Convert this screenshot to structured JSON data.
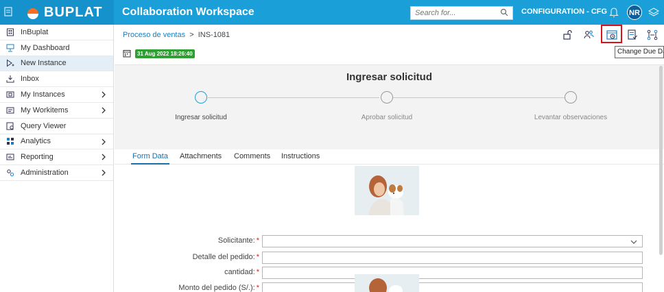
{
  "topbar": {
    "logo_text": "BUPLAT",
    "app_title": "Collaboration Workspace",
    "search_placeholder": "Search for...",
    "config_label": "CONFIGURATION - CFG",
    "avatar_initials": "NR",
    "colors": {
      "bar": "#1a9fd9",
      "brand_dot_a": "#f36f21",
      "brand_dot_b": "#ffffff"
    }
  },
  "sidebar": {
    "items": [
      {
        "label": "InBuplat",
        "icon": "building-icon",
        "has_submenu": false
      },
      {
        "label": "My Dashboard",
        "icon": "dashboard-icon",
        "has_submenu": false
      },
      {
        "label": "New Instance",
        "icon": "new-instance-icon",
        "has_submenu": false,
        "active": true
      },
      {
        "label": "Inbox",
        "icon": "inbox-icon",
        "has_submenu": false
      },
      {
        "label": "My Instances",
        "icon": "instances-icon",
        "has_submenu": true
      },
      {
        "label": "My Workitems",
        "icon": "workitems-icon",
        "has_submenu": true
      },
      {
        "label": "Query Viewer",
        "icon": "query-icon",
        "has_submenu": false
      },
      {
        "label": "Analytics",
        "icon": "analytics-icon",
        "has_submenu": true
      },
      {
        "label": "Reporting",
        "icon": "reporting-icon",
        "has_submenu": true
      },
      {
        "label": "Administration",
        "icon": "admin-icon",
        "has_submenu": true
      }
    ]
  },
  "breadcrumb": {
    "parent": "Proceso de ventas",
    "separator": ">",
    "current": "INS-1081"
  },
  "toolbar": {
    "icons": [
      "unlock-icon",
      "users-icon",
      "change-due-date-icon",
      "form-icon",
      "workflow-icon"
    ],
    "tooltip": "Change Due Date"
  },
  "due_date": "31 Aug 2022 18:26:40",
  "stage": {
    "title": "Ingresar solicitud",
    "steps": [
      {
        "label": "Ingresar solicitud",
        "active": true
      },
      {
        "label": "Aprobar solicitud",
        "active": false
      },
      {
        "label": "Levantar observaciones",
        "active": false
      }
    ]
  },
  "tabs": [
    {
      "label": "Form Data",
      "active": true
    },
    {
      "label": "Attachments",
      "active": false
    },
    {
      "label": "Comments",
      "active": false
    },
    {
      "label": "Instructions",
      "active": false
    }
  ],
  "form": {
    "fields": [
      {
        "label": "Solicitante:",
        "value": "",
        "type": "select",
        "required": true
      },
      {
        "label": "Detalle del pedido:",
        "value": "",
        "type": "text",
        "required": true
      },
      {
        "label": "cantidad:",
        "value": "",
        "type": "text",
        "required": true
      },
      {
        "label": "Monto del pedido (S/.):",
        "value": "",
        "type": "text",
        "required": true
      }
    ],
    "required_mark": "*"
  }
}
